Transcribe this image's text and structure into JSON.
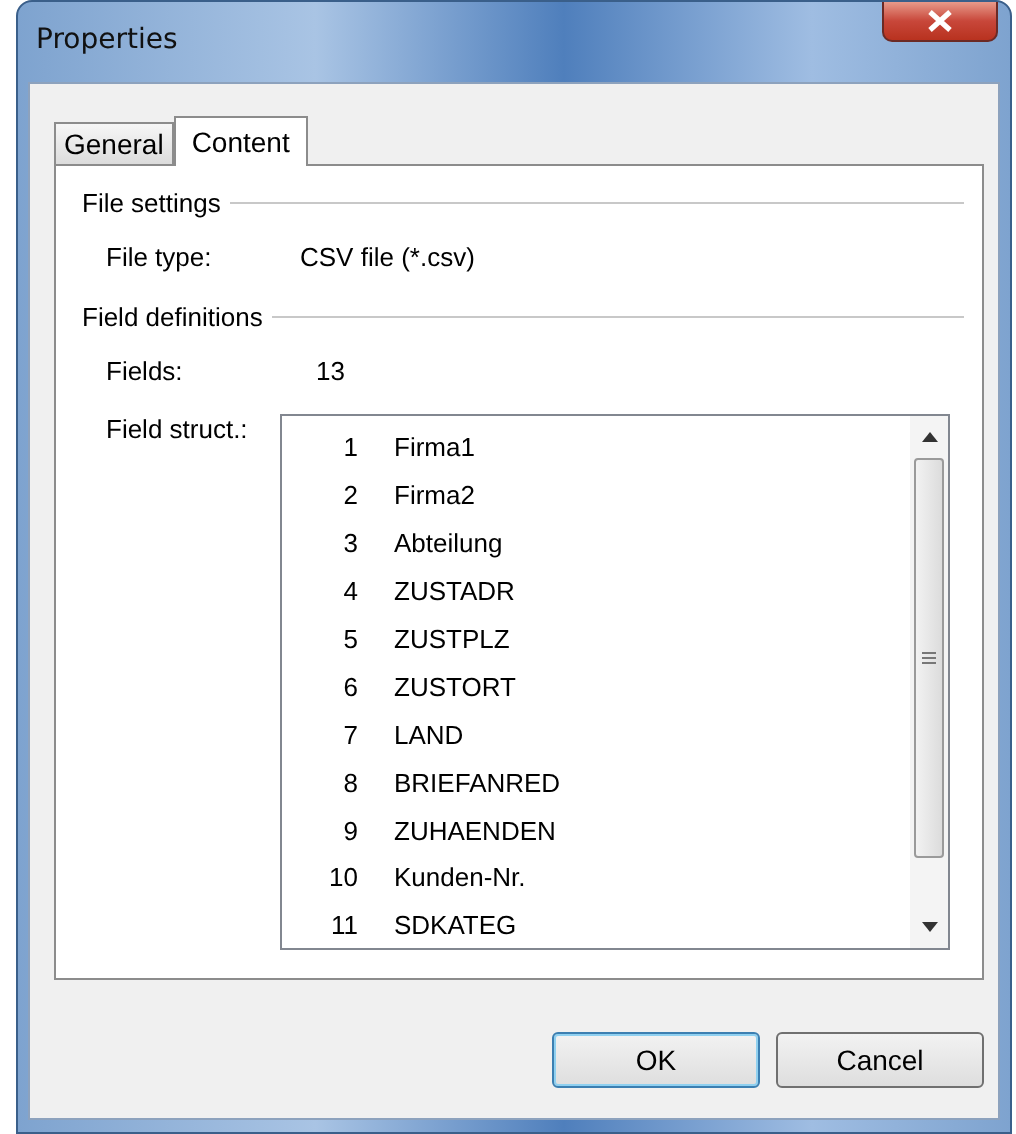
{
  "window": {
    "title": "Properties"
  },
  "tabs": [
    {
      "label": "General",
      "selected": false
    },
    {
      "label": "Content",
      "selected": true
    }
  ],
  "file_settings": {
    "heading": "File settings",
    "file_type_label": "File type:",
    "file_type_value": "CSV file (*.csv)"
  },
  "field_definitions": {
    "heading": "Field definitions",
    "fields_label": "Fields:",
    "fields_value": "13",
    "structure_label": "Field struct.:",
    "structure_items": [
      {
        "number": "1",
        "name": "Firma1"
      },
      {
        "number": "2",
        "name": "Firma2"
      },
      {
        "number": "3",
        "name": "Abteilung"
      },
      {
        "number": "4",
        "name": "ZUSTADR"
      },
      {
        "number": "5",
        "name": "ZUSTPLZ"
      },
      {
        "number": "6",
        "name": "ZUSTORT"
      },
      {
        "number": "7",
        "name": "LAND"
      },
      {
        "number": "8",
        "name": "BRIEFANRED"
      },
      {
        "number": "9",
        "name": "ZUHAENDEN"
      },
      {
        "number": "10",
        "name": "Kunden-Nr."
      },
      {
        "number": "11",
        "name": "SDKATEG"
      }
    ]
  },
  "buttons": [
    {
      "label": "OK",
      "focused": true
    },
    {
      "label": "Cancel",
      "focused": false
    }
  ]
}
